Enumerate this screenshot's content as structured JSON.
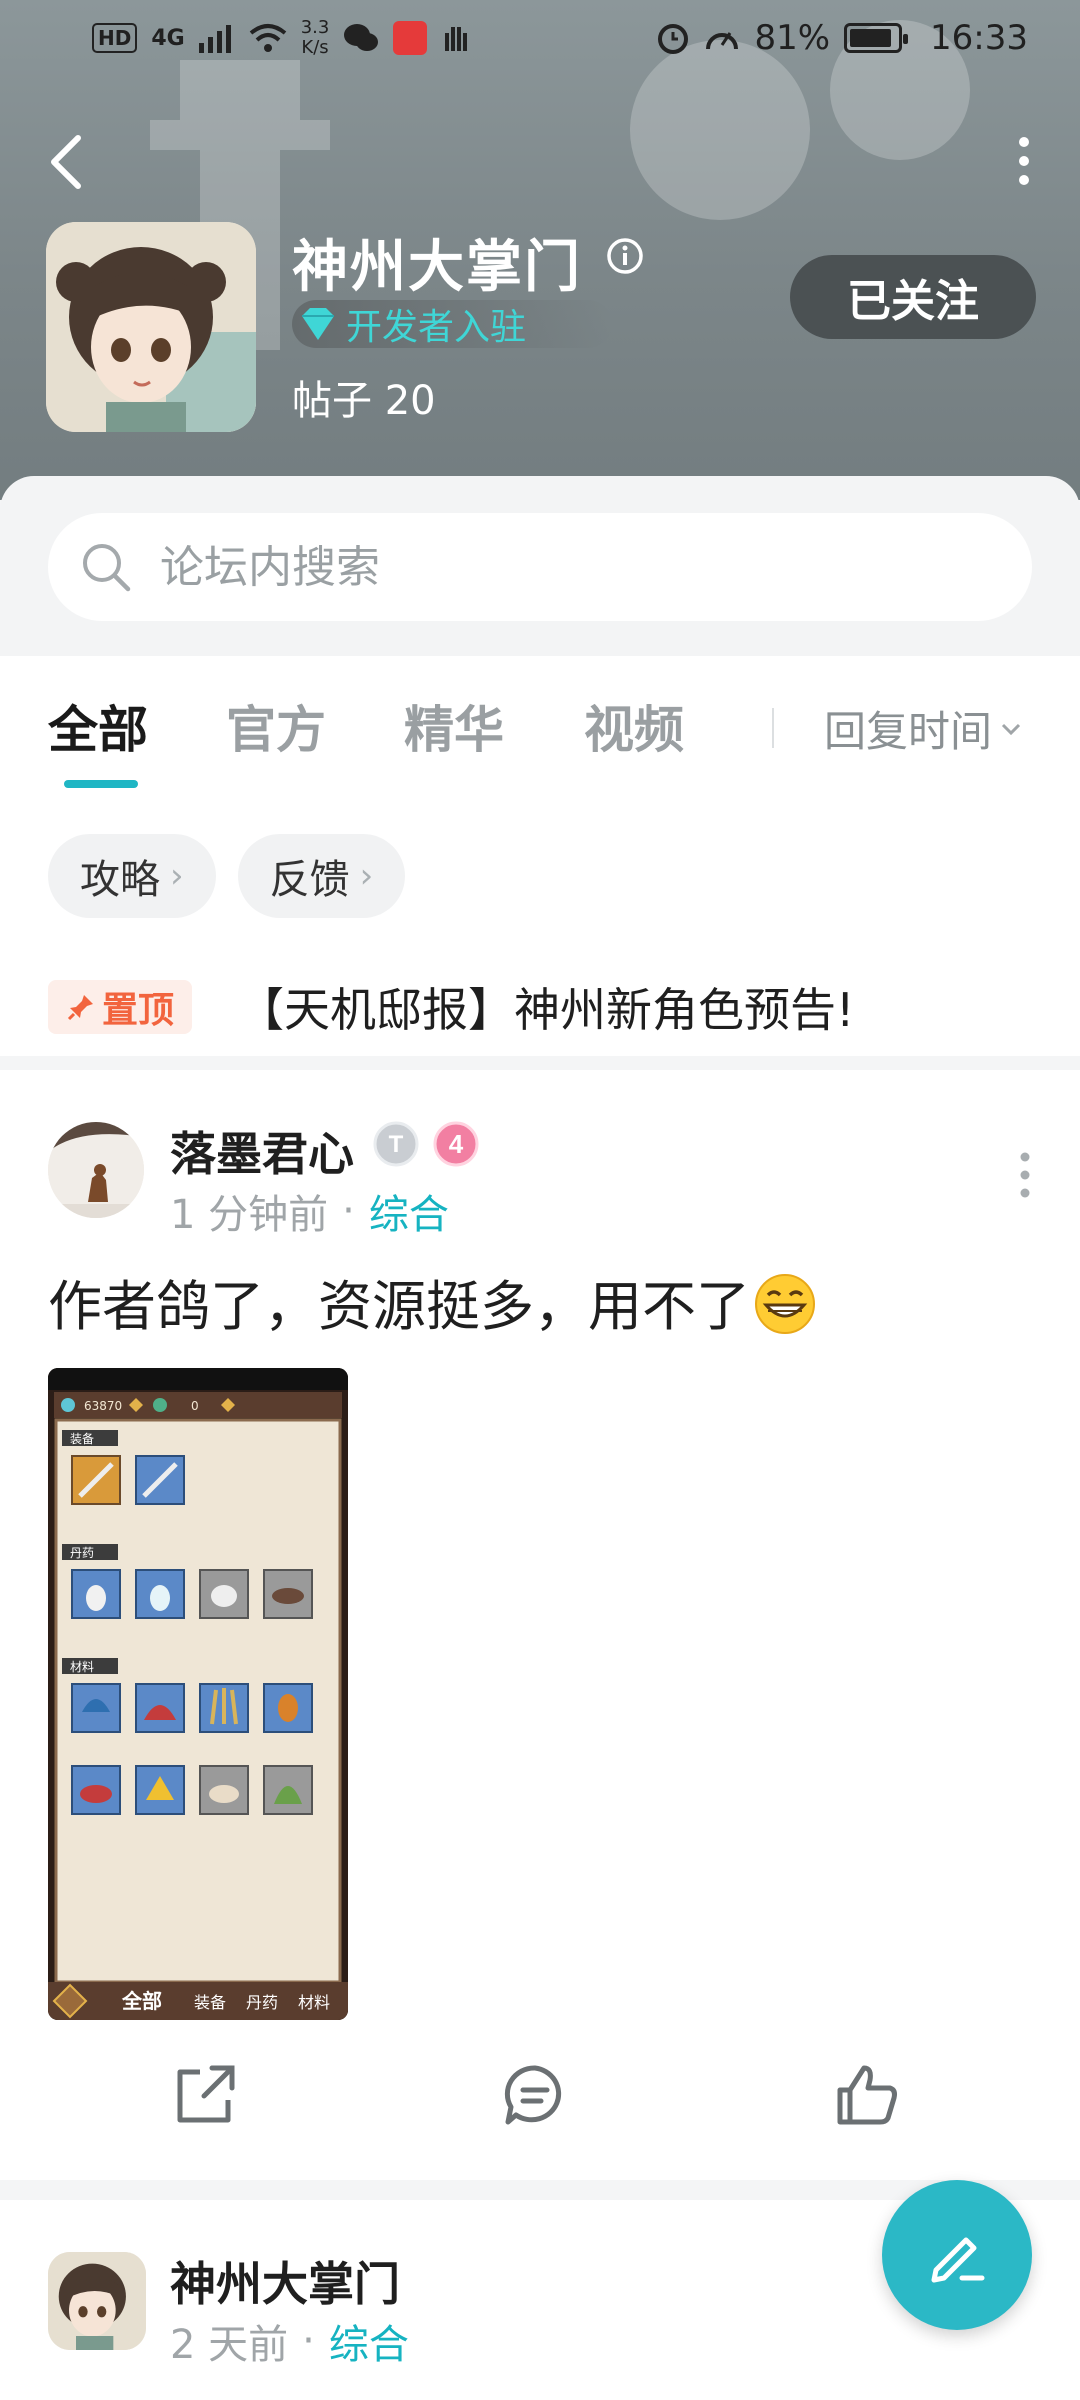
{
  "status_bar": {
    "left_chip": "HD",
    "network": "4G",
    "speed_value": "3.3",
    "speed_unit": "K/s",
    "battery": "81%",
    "time": "16:33"
  },
  "forum": {
    "title": "神州大掌门",
    "badge": "开发者入驻",
    "posts_label": "帖子 20",
    "follow_button": "已关注"
  },
  "search": {
    "placeholder": "论坛内搜索"
  },
  "tabs": [
    "全部",
    "官方",
    "精华",
    "视频"
  ],
  "active_tab": "全部",
  "sort": {
    "label": "回复时间"
  },
  "chips": [
    "攻略",
    "反馈"
  ],
  "pinned": {
    "badge": "置顶",
    "title": "【天机邸报】神州新角色预告!"
  },
  "posts": [
    {
      "author": "落墨君心",
      "level_badge": "4",
      "title_badge": "T",
      "time": "1 分钟前",
      "category": "综合",
      "text": "作者鸽了，资源挺多，用不了",
      "image": {
        "currency_1": "63870",
        "currency_2": "0",
        "sections": [
          "装备",
          "丹药",
          "材料"
        ],
        "bottom_tabs": [
          "全部",
          "装备",
          "丹药",
          "材料"
        ]
      }
    },
    {
      "author": "神州大掌门",
      "time": "2 天前",
      "category": "综合"
    }
  ],
  "colors": {
    "accent": "#1fb6c4",
    "pin": "#f2643e",
    "header_bg": "#7c8689"
  },
  "icons": {
    "back": "chevron-left-icon",
    "more": "more-vertical-icon",
    "info": "info-icon",
    "search": "search-icon",
    "share": "share-icon",
    "comment": "comment-icon",
    "like": "thumb-up-icon",
    "compose": "pen-icon"
  }
}
